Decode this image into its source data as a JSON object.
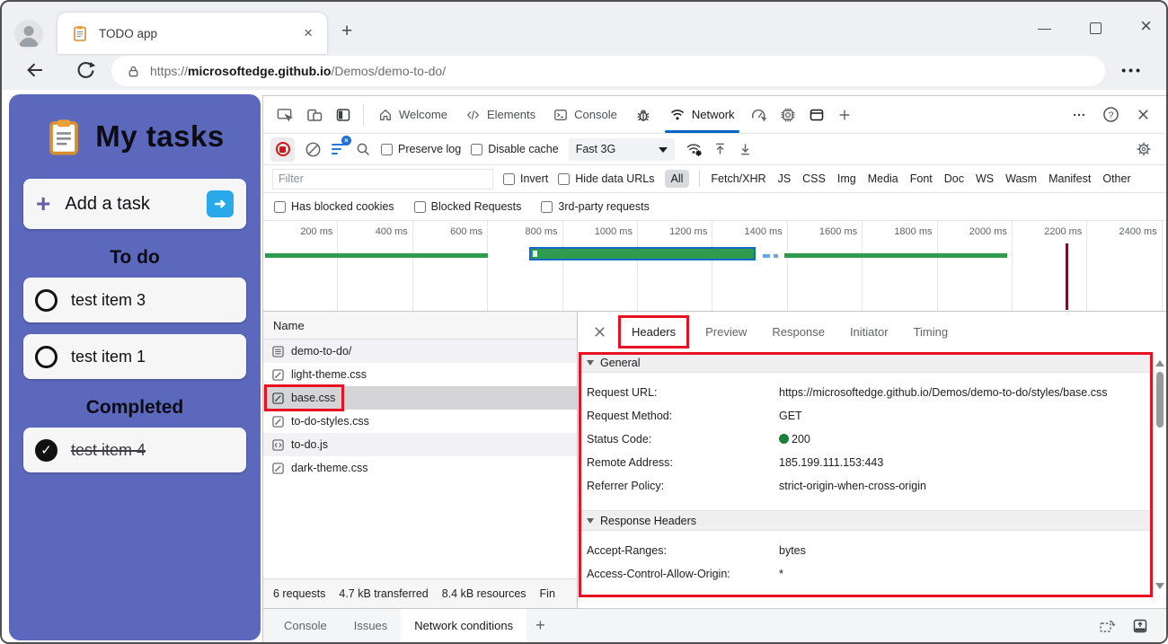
{
  "browser": {
    "tab_title": "TODO app",
    "tab_close": "×",
    "new_tab": "+",
    "url_scheme": "https://",
    "url_host": "microsoftedge.github.io",
    "url_path": "/Demos/demo-to-do/",
    "more_menu": "•••"
  },
  "tasks_app": {
    "title": "My tasks",
    "add_plus": "+",
    "add_label": "Add a task",
    "go_arrow": "➜",
    "todo_heading": "To do",
    "completed_heading": "Completed",
    "todo_items": [
      {
        "label": "test item 3"
      },
      {
        "label": "test item 1"
      }
    ],
    "completed_items": [
      {
        "label": "test item 4",
        "check": "✓"
      }
    ]
  },
  "devtools": {
    "main_tabs": {
      "welcome": "Welcome",
      "elements": "Elements",
      "console": "Console",
      "network": "Network"
    },
    "toolbar": {
      "preserve_log": "Preserve log",
      "disable_cache": "Disable cache",
      "throttling": "Fast 3G"
    },
    "filter": {
      "placeholder": "Filter",
      "invert": "Invert",
      "hide_data_urls": "Hide data URLs",
      "types": [
        "All",
        "Fetch/XHR",
        "JS",
        "CSS",
        "Img",
        "Media",
        "Font",
        "Doc",
        "WS",
        "Wasm",
        "Manifest",
        "Other"
      ]
    },
    "blocked_row": [
      "Has blocked cookies",
      "Blocked Requests",
      "3rd-party requests"
    ],
    "overview": {
      "ticks": [
        "200 ms",
        "400 ms",
        "600 ms",
        "800 ms",
        "1000 ms",
        "1200 ms",
        "1400 ms",
        "1600 ms",
        "1800 ms",
        "2000 ms",
        "2200 ms",
        "2400 ms"
      ]
    },
    "requests": {
      "header": "Name",
      "items": [
        {
          "name": "demo-to-do/",
          "icon": "document"
        },
        {
          "name": "light-theme.css",
          "icon": "stylesheet"
        },
        {
          "name": "base.css",
          "icon": "stylesheet",
          "selected": true
        },
        {
          "name": "to-do-styles.css",
          "icon": "stylesheet"
        },
        {
          "name": "to-do.js",
          "icon": "script"
        },
        {
          "name": "dark-theme.css",
          "icon": "stylesheet"
        }
      ],
      "summary": {
        "requests": "6 requests",
        "transferred": "4.7 kB transferred",
        "resources": "8.4 kB resources",
        "more": "Fin"
      }
    },
    "detail": {
      "tabs": [
        "Headers",
        "Preview",
        "Response",
        "Initiator",
        "Timing"
      ],
      "general": {
        "title": "General",
        "rows": [
          [
            "Request URL:",
            "https://microsoftedge.github.io/Demos/demo-to-do/styles/base.css"
          ],
          [
            "Request Method:",
            "GET"
          ],
          [
            "Status Code:",
            "200"
          ],
          [
            "Remote Address:",
            "185.199.111.153:443"
          ],
          [
            "Referrer Policy:",
            "strict-origin-when-cross-origin"
          ]
        ]
      },
      "response_headers": {
        "title": "Response Headers",
        "rows": [
          [
            "Accept-Ranges:",
            "bytes"
          ],
          [
            "Access-Control-Allow-Origin:",
            "*"
          ]
        ]
      }
    },
    "drawer": {
      "tabs": [
        "Console",
        "Issues",
        "Network conditions"
      ],
      "new_tab": "+"
    }
  },
  "colors": {
    "sidebar_blue": "#5b68bb",
    "annotation_red": "#e81123",
    "active_tab_accent": "#0067c0",
    "status_green": "#1a7f37",
    "arrow_button_blue": "#29a9ea",
    "timeline_green": "#2e9b4f",
    "timeline_selection_blue": "#1667c9",
    "load_event_red": "#7a1023"
  }
}
